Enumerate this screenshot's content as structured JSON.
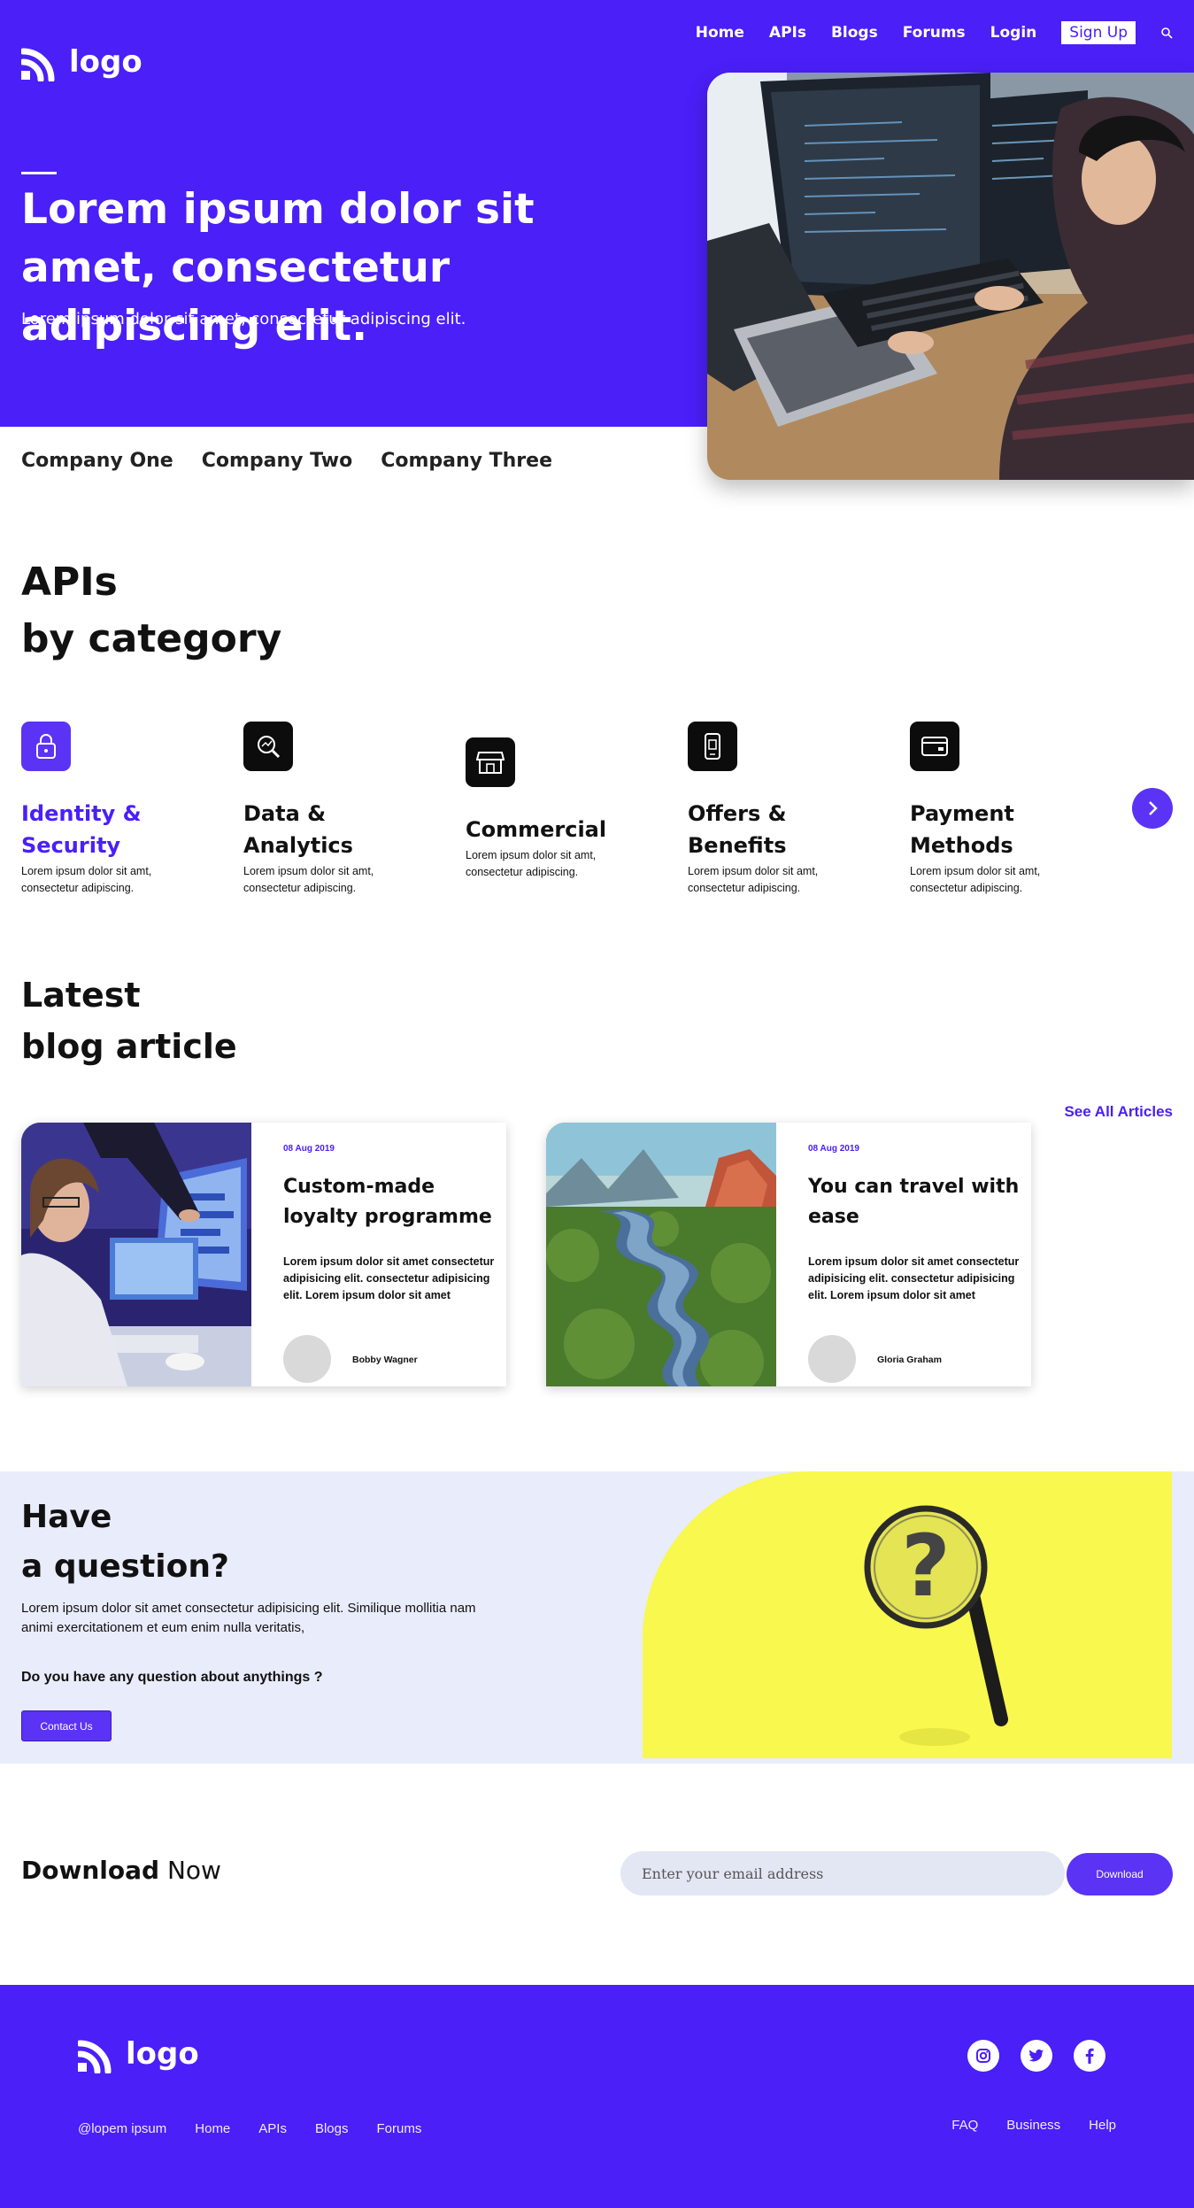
{
  "brand": {
    "logo_text": "logo",
    "primary_color": "#4a1ff8",
    "accent_color": "#5b33f5"
  },
  "nav": {
    "items": [
      "Home",
      "APIs",
      "Blogs",
      "Forums",
      "Login"
    ],
    "signup": "Sign Up",
    "search_icon": "search-icon"
  },
  "hero": {
    "title": "Lorem ipsum dolor sit amet, consectetur adipiscing elit.",
    "subtitle": "Lorem ipsum dolor sit amet, consectetur adipiscing elit."
  },
  "companies": [
    "Company One",
    "Company Two",
    "Company Three"
  ],
  "apis": {
    "title_line1": "APIs",
    "title_line2": "by category",
    "categories": [
      {
        "name": "Identity & Security",
        "desc": "Lorem ipsum dolor sit amt, consectetur adipiscing.",
        "icon": "lock-icon",
        "active": true
      },
      {
        "name": "Data & Analytics",
        "desc": "Lorem ipsum dolor sit amt, consectetur adipiscing.",
        "icon": "magnifier-chart-icon",
        "active": false
      },
      {
        "name": "Commercial",
        "desc": "Lorem ipsum dolor sit amt, consectetur adipiscing.",
        "icon": "store-icon",
        "active": false
      },
      {
        "name": "Offers & Benefits",
        "desc": "Lorem ipsum dolor sit amt, consectetur adipiscing.",
        "icon": "mobile-offer-icon",
        "active": false
      },
      {
        "name": "Payment Methods",
        "desc": "Lorem ipsum dolor sit amt, consectetur adipiscing.",
        "icon": "credit-card-icon",
        "active": false
      }
    ],
    "next_icon": "chevron-right-icon"
  },
  "blog": {
    "title_line1": "Latest",
    "title_line2": "blog article",
    "see_all": "See All Articles",
    "articles": [
      {
        "date": "08 Aug 2019",
        "title": "Custom-made loyalty programme",
        "body": "Lorem ipsum dolor sit amet consectetur adipisicing elit. consectetur adipisicing elit. Lorem ipsum dolor sit amet",
        "author": "Bobby Wagner"
      },
      {
        "date": "08 Aug 2019",
        "title": "You can travel with ease",
        "body": "Lorem ipsum dolor sit amet consectetur adipisicing elit. consectetur adipisicing elit. Lorem ipsum dolor sit amet",
        "author": "Gloria Graham"
      }
    ]
  },
  "question": {
    "title_line1": "Have",
    "title_line2": "a question?",
    "text": "Lorem ipsum dolor sit amet consectetur adipisicing elit. Similique mollitia nam animi exercitationem et eum enim nulla veritatis,",
    "ask": "Do you have any question about anythings ?",
    "button": "Contact Us"
  },
  "download": {
    "title_bold": "Download",
    "title_rest": " Now",
    "placeholder": "Enter your email address",
    "button": "Download"
  },
  "footer": {
    "logo_text": "logo",
    "links": [
      "@lopem ipsum",
      "Home",
      "APIs",
      "Blogs",
      "Forums"
    ],
    "right_links": [
      "FAQ",
      "Business",
      "Help"
    ],
    "socials": [
      "instagram-icon",
      "twitter-icon",
      "facebook-icon"
    ]
  }
}
